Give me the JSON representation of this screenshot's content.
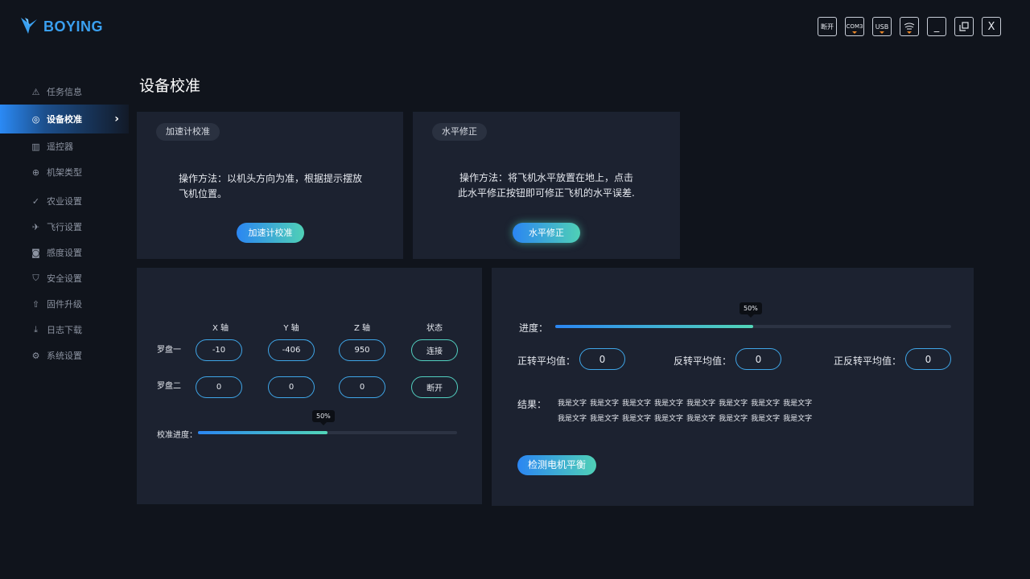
{
  "app": {
    "logo_text": "BOYING"
  },
  "window_controls": [
    {
      "label": "断开",
      "name": "disconnect-button",
      "marker": false
    },
    {
      "label": "COM3",
      "name": "com-port-button",
      "marker": true
    },
    {
      "label": "USB",
      "name": "usb-button",
      "marker": true
    },
    {
      "label": "",
      "name": "drone-icon-button",
      "marker": true
    },
    {
      "label": "_",
      "name": "minimize-button",
      "marker": false
    },
    {
      "label": "",
      "name": "restore-button",
      "marker": false
    },
    {
      "label": "X",
      "name": "close-button",
      "marker": false
    }
  ],
  "sidebar": {
    "items": [
      {
        "label": "任务信息",
        "icon": "warning-icon",
        "glyph": "⚠"
      },
      {
        "label": "设备校准",
        "icon": "compass-icon",
        "glyph": "◎",
        "active": true
      },
      {
        "label": "遥控器",
        "icon": "remote-icon",
        "glyph": "▥"
      },
      {
        "label": "机架类型",
        "icon": "crosshair-icon",
        "glyph": "⊕"
      },
      {
        "label": "农业设置",
        "icon": "leaf-icon",
        "glyph": "✓"
      },
      {
        "label": "飞行设置",
        "icon": "plane-icon",
        "glyph": "✈"
      },
      {
        "label": "感度设置",
        "icon": "sensor-icon",
        "glyph": "◙"
      },
      {
        "label": "安全设置",
        "icon": "shield-icon",
        "glyph": "⛉"
      },
      {
        "label": "固件升级",
        "icon": "upgrade-icon",
        "glyph": "⇧"
      },
      {
        "label": "日志下载",
        "icon": "download-icon",
        "glyph": "⤓"
      },
      {
        "label": "系统设置",
        "icon": "gear-icon",
        "glyph": "⚙"
      }
    ]
  },
  "page": {
    "title": "设备校准"
  },
  "accel": {
    "tag": "加速计校准",
    "instruction_line1": "操作方法：以机头方向为准，根据提示摆放",
    "instruction_line2": "飞机位置。",
    "button": "加速计校准"
  },
  "level": {
    "tag": "水平修正",
    "instruction_line1": "操作方法：将飞机水平放置在地上，点击",
    "instruction_line2": "此水平修正按钮即可修正飞机的水平误差.",
    "button": "水平修正"
  },
  "compass": {
    "headers": [
      "X 轴",
      "Y 轴",
      "Z 轴",
      "状态"
    ],
    "rows": [
      {
        "label": "罗盘一",
        "values": [
          "-10",
          "-406",
          "950"
        ],
        "state": "连接"
      },
      {
        "label": "罗盘二",
        "values": [
          "0",
          "0",
          "0"
        ],
        "state": "断开"
      }
    ],
    "progress_label": "校准进度：",
    "progress": 0.5,
    "progress_text": "50%"
  },
  "motor": {
    "progress_label": "进度：",
    "progress": 0.5,
    "progress_text": "50%",
    "fields": [
      {
        "label": "正转平均值：",
        "value": "0"
      },
      {
        "label": "反转平均值：",
        "value": "0"
      },
      {
        "label": "正反转平均值：",
        "value": "0"
      }
    ],
    "result_label": "结果：",
    "results": [
      "我是文字",
      "我是文字",
      "我是文字",
      "我是文字",
      "我是文字",
      "我是文字",
      "我是文字",
      "我是文字",
      "我是文字",
      "我是文字",
      "我是文字",
      "我是文字",
      "我是文字",
      "我是文字",
      "我是文字",
      "我是文字"
    ],
    "button": "检测电机平衡"
  },
  "colors": {
    "accent_blue": "#2b86f2",
    "accent_teal": "#4fd0b6",
    "marker_orange": "#f08a2a"
  }
}
